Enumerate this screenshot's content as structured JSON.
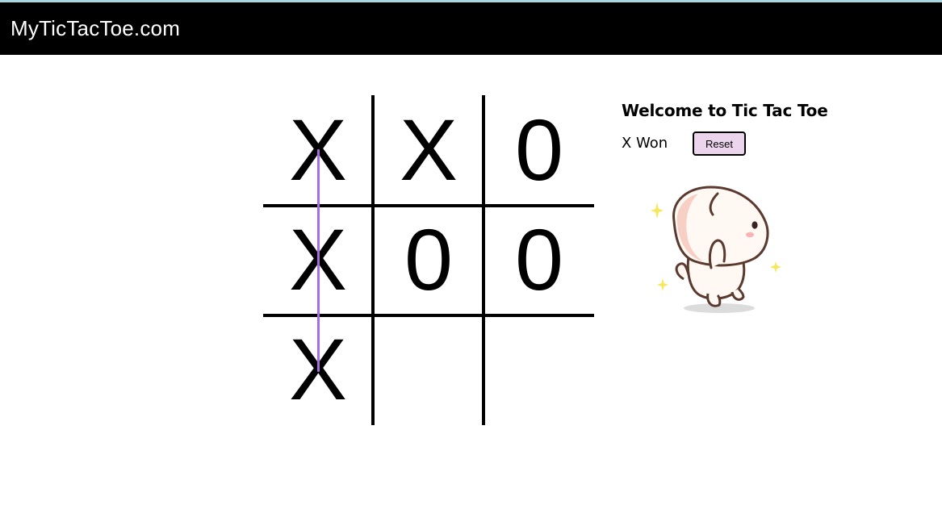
{
  "app": {
    "brand": "MyTicTacToe.com"
  },
  "board": {
    "cells": [
      "X",
      "X",
      "0",
      "X",
      "0",
      "0",
      "X",
      "",
      ""
    ],
    "winning_line": "column-1"
  },
  "panel": {
    "welcome": "Welcome to Tic Tac Toe",
    "status": "X Won",
    "reset_label": "Reset"
  },
  "mascot": {
    "icon": "cat-sticker-icon"
  },
  "colors": {
    "navbar": "#000000",
    "top_stripe": "#a7d8e0",
    "win_line": "#a86be0",
    "reset_button": "#ecd5ec"
  }
}
